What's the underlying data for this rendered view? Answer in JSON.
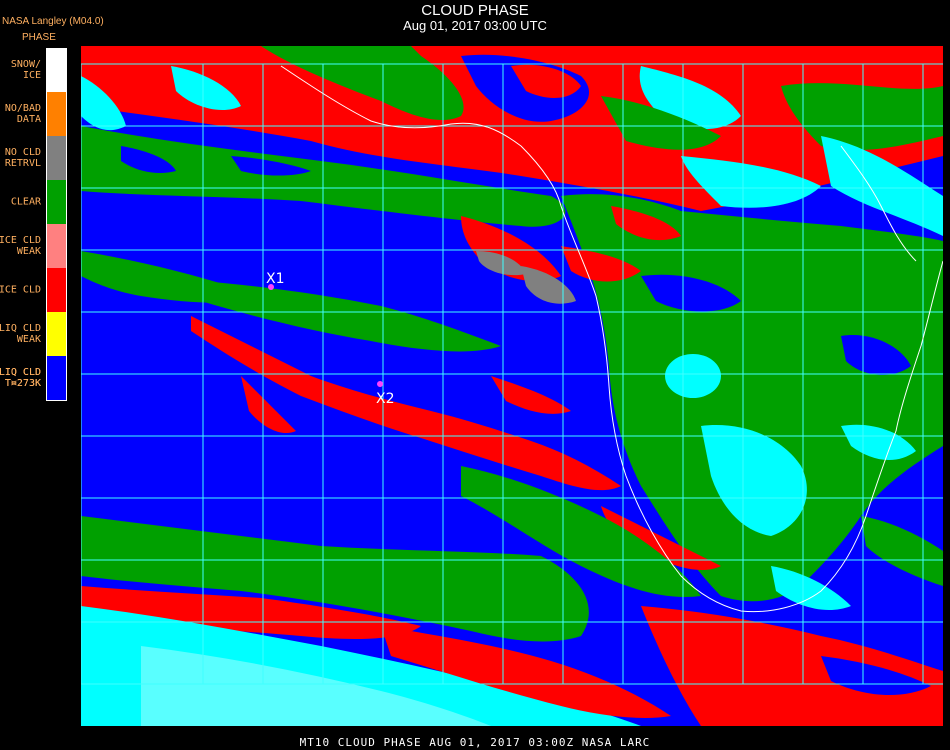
{
  "header": {
    "title": "CLOUD PHASE",
    "datetime": "Aug 01, 2017 03:00 UTC",
    "producer": "NASA Langley (M04.0)",
    "legend_title": "PHASE"
  },
  "legend": [
    {
      "label": "SNOW/\nICE",
      "color": "#ffffff"
    },
    {
      "label": "NO/BAD\nDATA",
      "color": "#ff8000"
    },
    {
      "label": "NO CLD\nRETRVL",
      "color": "#808080"
    },
    {
      "label": "CLEAR",
      "color": "#00a000"
    },
    {
      "label": "ICE CLD\nWEAK",
      "color": "#ff8080"
    },
    {
      "label": "ICE CLD",
      "color": "#ff0000"
    },
    {
      "label": "LIQ CLD\nWEAK",
      "color": "#ffff00"
    },
    {
      "label": "LIQ CLD\nT<273K",
      "color": "#00ffff"
    },
    {
      "label": "LIQ CLD\nT>273K",
      "color": "#0000ff"
    }
  ],
  "markers": [
    {
      "label": "X1",
      "color": "#ff40ff"
    },
    {
      "label": "X2",
      "color": "#ff40ff"
    }
  ],
  "colors": {
    "ocean_liquid": "#0000ff",
    "land_clear": "#00a000",
    "ice": "#ff0000",
    "cold_liquid": "#00ffff",
    "grid": "#40ffff",
    "coast": "#ffffff"
  },
  "footer": "MT10  CLOUD PHASE   AUG 01, 2017 03:00Z   NASA LARC"
}
